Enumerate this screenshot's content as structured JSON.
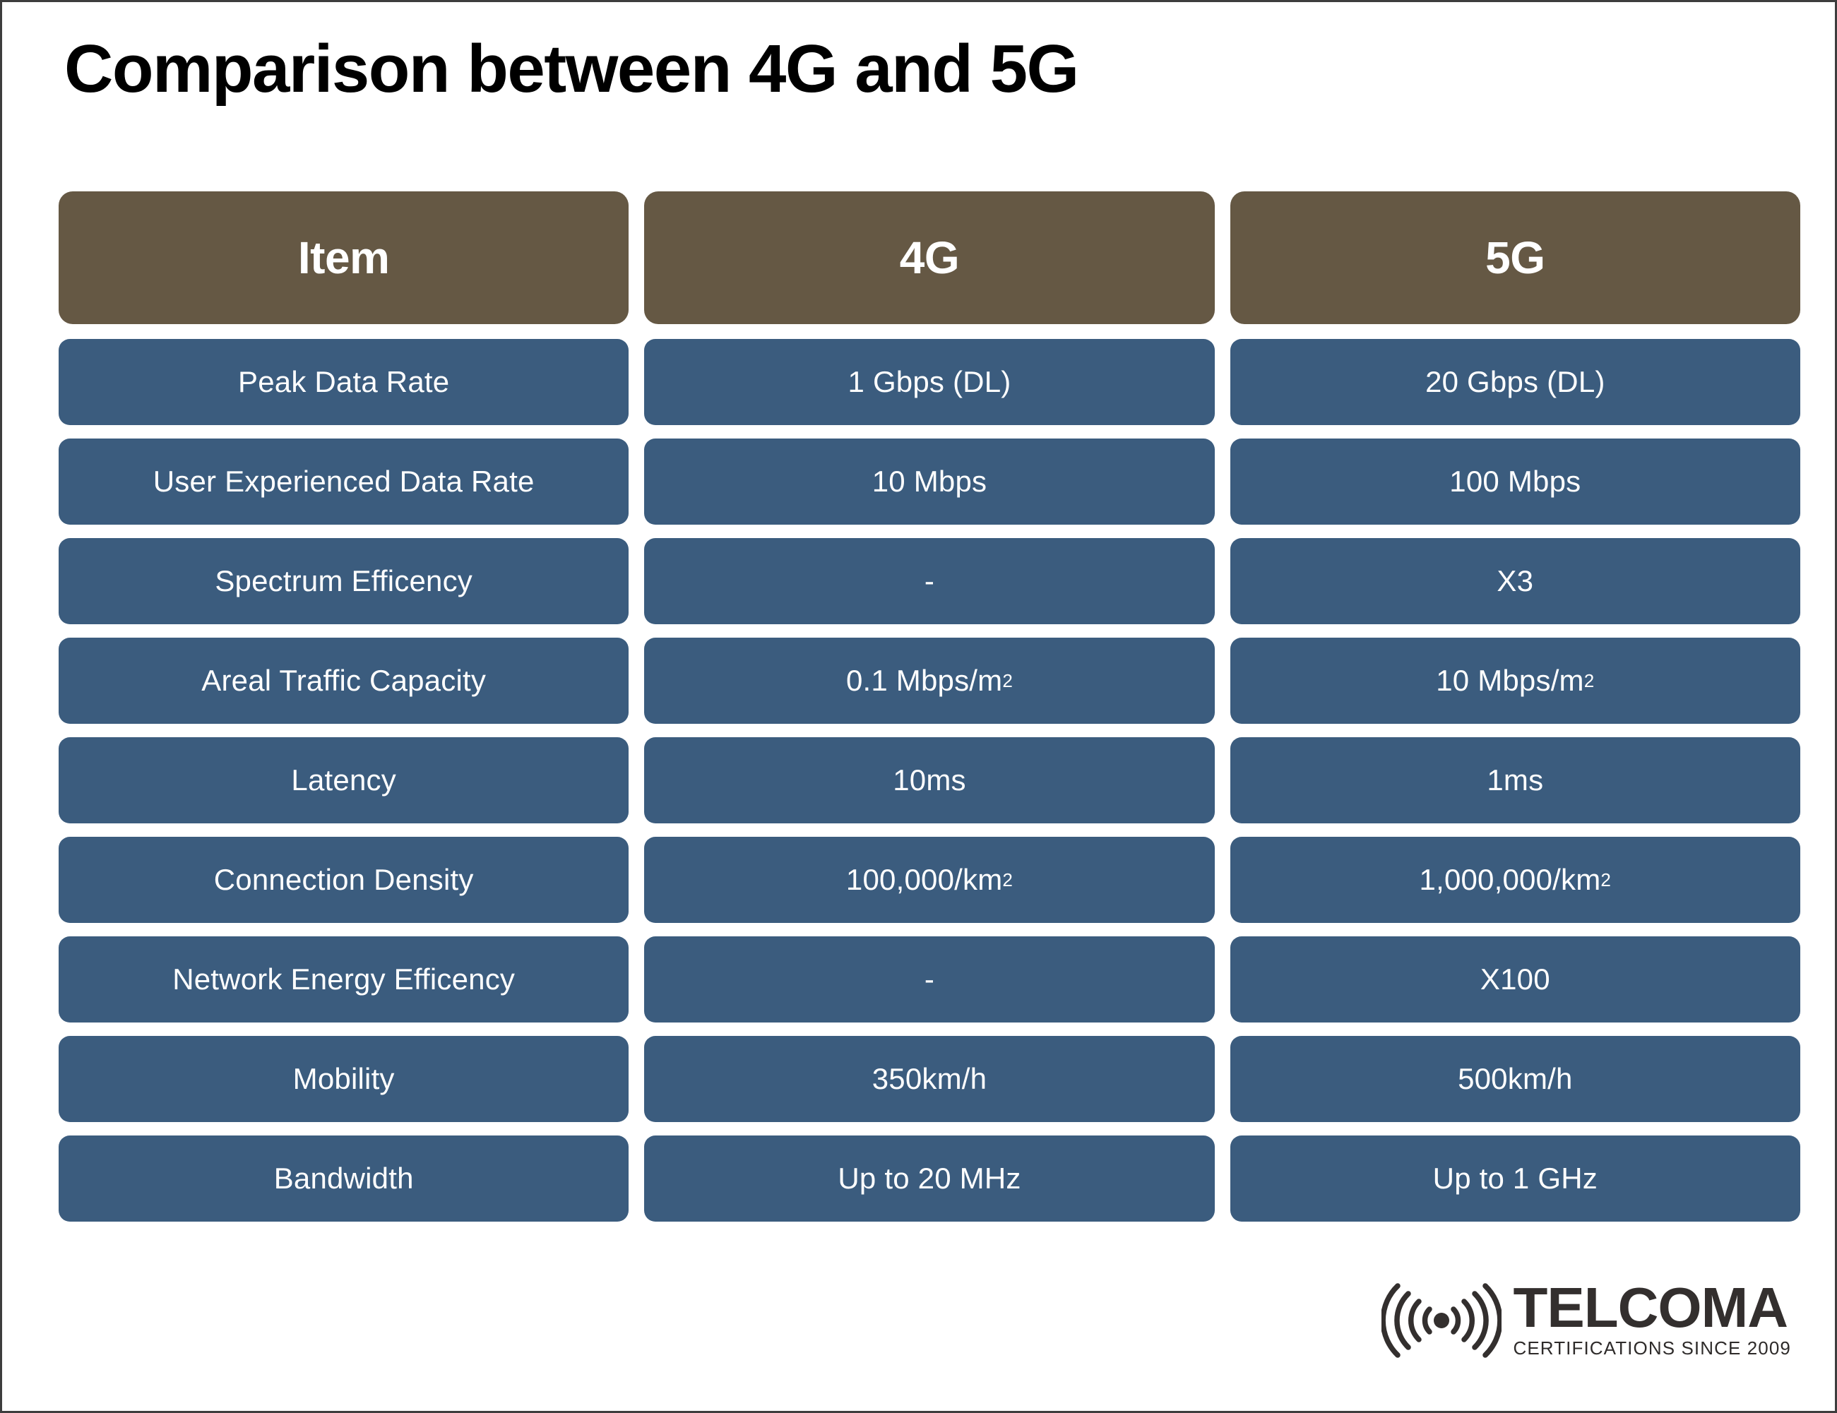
{
  "page": {
    "title": "Comparison between 4G and 5G"
  },
  "table": {
    "headers": [
      "Item",
      "4G",
      "5G"
    ],
    "rows": [
      {
        "item": "Peak Data Rate",
        "g4": "1 Gbps (DL)",
        "g5": "20 Gbps (DL)"
      },
      {
        "item": "User Experienced Data Rate",
        "g4": "10 Mbps",
        "g5": "100 Mbps"
      },
      {
        "item": "Spectrum Efficency",
        "g4": "-",
        "g5": "X3"
      },
      {
        "item": "Areal Traffic Capacity",
        "g4": "0.1 Mbps/m",
        "g4_sup": "2",
        "g5": "10 Mbps/m",
        "g5_sup": "2"
      },
      {
        "item": "Latency",
        "g4": "10ms",
        "g5": "1ms"
      },
      {
        "item": "Connection Density",
        "g4": "100,000/km",
        "g4_sup": "2",
        "g5": "1,000,000/km",
        "g5_sup": "2"
      },
      {
        "item": "Network Energy Efficency",
        "g4": "-",
        "g5": "X100"
      },
      {
        "item": "Mobility",
        "g4": "350km/h",
        "g5": "500km/h"
      },
      {
        "item": "Bandwidth",
        "g4": "Up to 20 MHz",
        "g5": "Up to 1 GHz"
      }
    ]
  },
  "logo": {
    "name": "TELCOMA",
    "tagline": "CERTIFICATIONS SINCE 2009",
    "icon": "signal-wave-icon"
  },
  "colors": {
    "header_cell": "#655844",
    "body_cell": "#3b5c7e",
    "cell_text": "#ffffff",
    "title_text": "#000000",
    "background": "#ffffff",
    "logo_text": "#332f2e"
  },
  "chart_data": {
    "type": "table",
    "title": "Comparison between 4G and 5G",
    "columns": [
      "Item",
      "4G",
      "5G"
    ],
    "rows": [
      [
        "Peak Data Rate",
        "1 Gbps (DL)",
        "20 Gbps (DL)"
      ],
      [
        "User Experienced Data Rate",
        "10 Mbps",
        "100 Mbps"
      ],
      [
        "Spectrum Efficency",
        "-",
        "X3"
      ],
      [
        "Areal Traffic Capacity",
        "0.1 Mbps/m2",
        "10 Mbps/m2"
      ],
      [
        "Latency",
        "10ms",
        "1ms"
      ],
      [
        "Connection Density",
        "100,000/km2",
        "1,000,000/km2"
      ],
      [
        "Network Energy Efficency",
        "-",
        "X100"
      ],
      [
        "Mobility",
        "350km/h",
        "500km/h"
      ],
      [
        "Bandwidth",
        "Up to 20 MHz",
        "Up to 1 GHz"
      ]
    ]
  }
}
